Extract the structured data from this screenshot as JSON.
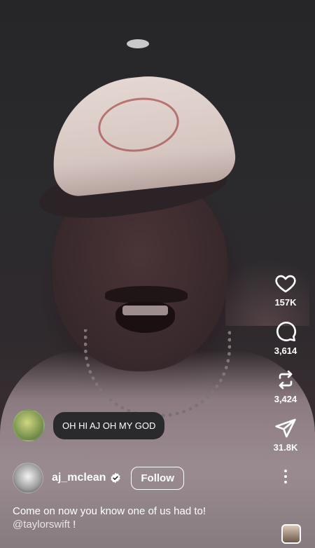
{
  "actions": {
    "likes": "157K",
    "comments": "3,614",
    "reposts": "3,424",
    "shares": "31.8K"
  },
  "comment": {
    "text": "OH HI AJ OH MY GOD"
  },
  "author": {
    "username": "aj_mclean",
    "follow_label": "Follow"
  },
  "caption": {
    "text": "Come on now you know one of us had to!",
    "mention": "@taylorswift",
    "suffix": " !"
  },
  "icons": [
    "heart-icon",
    "comment-icon",
    "repost-icon",
    "send-icon",
    "more-icon",
    "verified-icon"
  ],
  "colors": {
    "text": "#ffffff",
    "bubble": "#2a2a2c",
    "verified": "#3897f0"
  }
}
